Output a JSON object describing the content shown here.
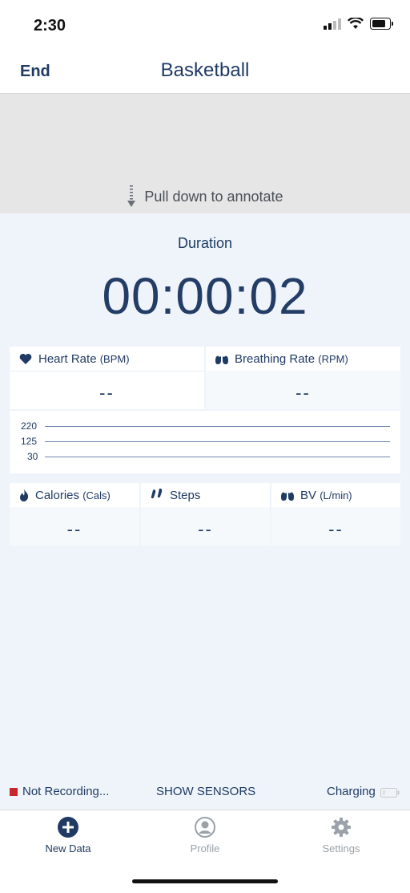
{
  "status": {
    "time": "2:30"
  },
  "nav": {
    "end_label": "End",
    "title": "Basketball"
  },
  "annotate": {
    "hint": "Pull down to annotate"
  },
  "duration": {
    "label": "Duration",
    "value": "00:00:02"
  },
  "heart_rate": {
    "label": "Heart Rate",
    "unit": "(BPM)",
    "value": "--"
  },
  "breathing_rate": {
    "label": "Breathing Rate",
    "unit": "(RPM)",
    "value": "--"
  },
  "gauge": {
    "levels": [
      "220",
      "125",
      "30"
    ]
  },
  "calories": {
    "label": "Calories",
    "unit": "(Cals)",
    "value": "--"
  },
  "steps": {
    "label": "Steps",
    "value": "--"
  },
  "bv": {
    "label": "BV",
    "unit": "(L/min)",
    "value": "--"
  },
  "footer": {
    "recording": "Not Recording...",
    "show_sensors": "SHOW SENSORS",
    "charging": "Charging"
  },
  "tabs": [
    {
      "label": "New Data",
      "icon": "plus-circle-icon",
      "active": true
    },
    {
      "label": "Profile",
      "icon": "person-icon",
      "active": false
    },
    {
      "label": "Settings",
      "icon": "gear-icon",
      "active": false
    }
  ],
  "colors": {
    "accent": "#1f3a63",
    "recording": "#c8262b",
    "inactive": "#9aa1a8"
  }
}
